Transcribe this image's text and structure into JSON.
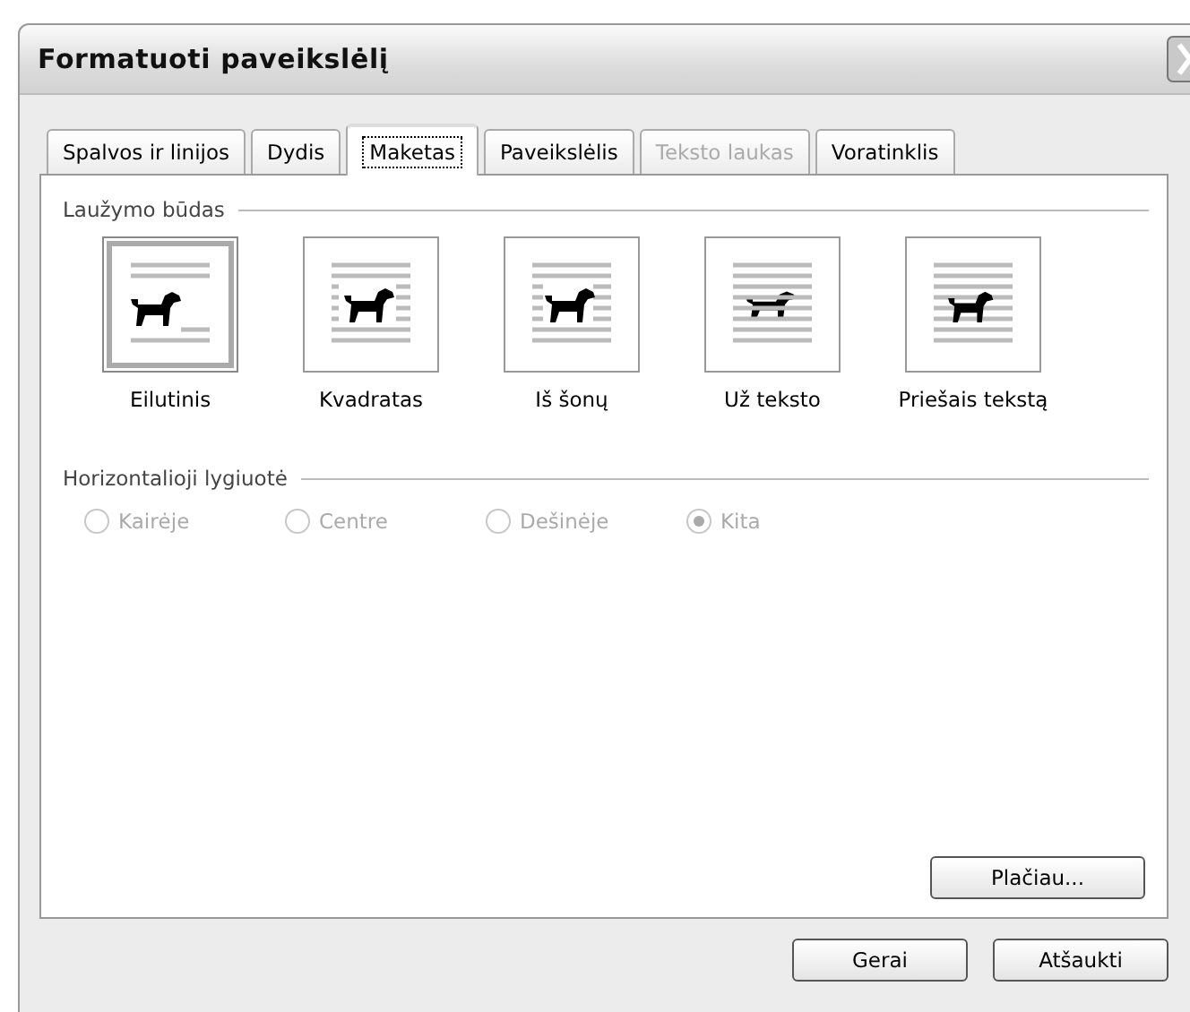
{
  "window": {
    "title": "Formatuoti paveikslėlį"
  },
  "tabs": [
    {
      "label": "Spalvos ir linijos",
      "selected": false,
      "disabled": false
    },
    {
      "label": "Dydis",
      "selected": false,
      "disabled": false
    },
    {
      "label": "Maketas",
      "selected": true,
      "disabled": false
    },
    {
      "label": "Paveikslėlis",
      "selected": false,
      "disabled": false
    },
    {
      "label": "Teksto laukas",
      "selected": false,
      "disabled": true
    },
    {
      "label": "Voratinklis",
      "selected": false,
      "disabled": false
    }
  ],
  "wrapping": {
    "label": "Laužymo būdas",
    "options": [
      {
        "label": "Eilutinis",
        "kind": "inline",
        "selected": true
      },
      {
        "label": "Kvadratas",
        "kind": "square",
        "selected": false
      },
      {
        "label": "Iš šonų",
        "kind": "tight",
        "selected": false
      },
      {
        "label": "Už teksto",
        "kind": "behind",
        "selected": false
      },
      {
        "label": "Priešais tekstą",
        "kind": "front",
        "selected": false
      }
    ]
  },
  "alignment": {
    "label": "Horizontalioji lygiuotė",
    "disabled": true,
    "options": [
      {
        "label": "Kairėje",
        "selected": false
      },
      {
        "label": "Centre",
        "selected": false
      },
      {
        "label": "Dešinėje",
        "selected": false
      },
      {
        "label": "Kita",
        "selected": true
      }
    ]
  },
  "advanced_button": "Plačiau...",
  "buttons": [
    "Gerai",
    "Atšaukti"
  ]
}
